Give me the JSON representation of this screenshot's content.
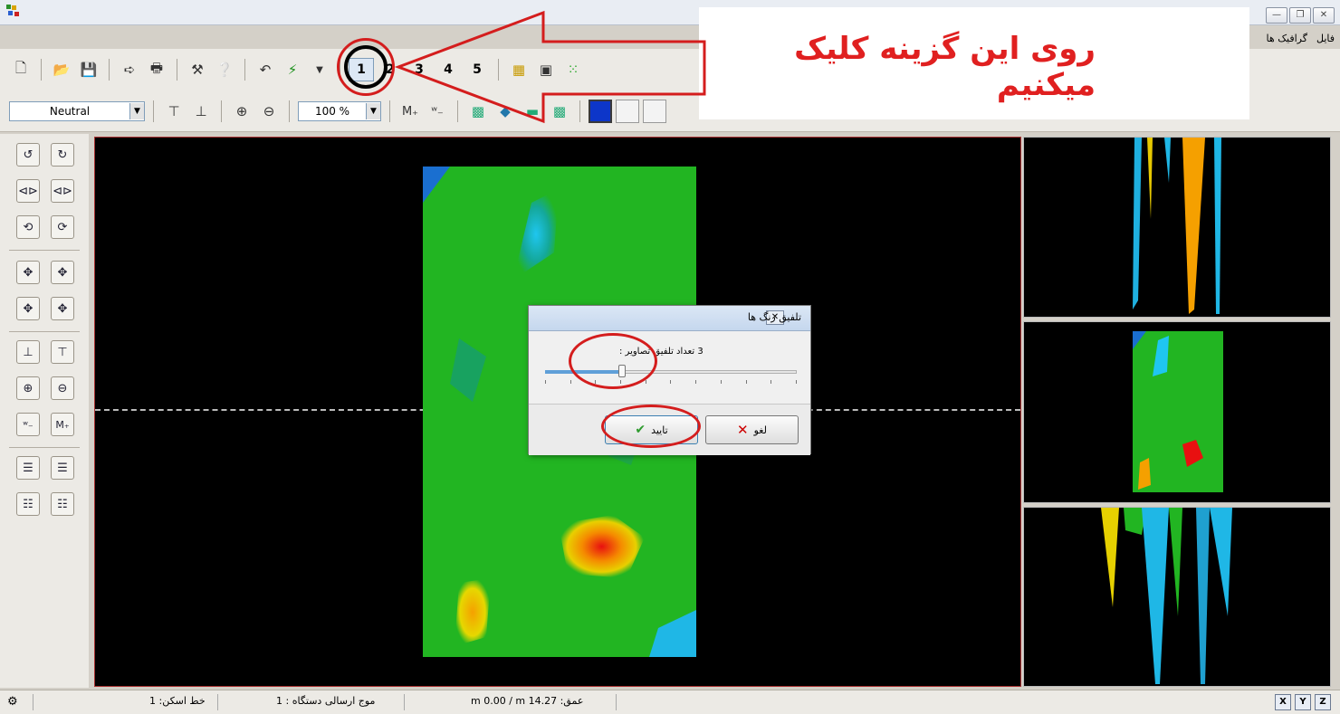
{
  "window": {
    "controls": [
      "—",
      "❐",
      "✕"
    ]
  },
  "menu": {
    "items": [
      "فایل",
      "گرافیک ها"
    ]
  },
  "toolbar": {
    "numbers": [
      "1",
      "2",
      "3",
      "4",
      "5"
    ],
    "palette_value": "Neutral",
    "zoom_value": "100 %"
  },
  "annotation": {
    "text": "روی این گزینه کلیک میکنیم"
  },
  "dialog": {
    "title": "تلفیق رنگ ها",
    "label": "3  تعداد تلفیق تصاویر :",
    "slider_value": 3,
    "slider_max": 10,
    "ok_label": "تایید",
    "cancel_label": "لغو"
  },
  "status": {
    "scan_line": "خط اسکن: 1",
    "device_wave": "موج ارسالی دستگاه : 1",
    "depth": "عمق: m 0.00 / m 14.27",
    "axes": [
      "X",
      "Y",
      "Z"
    ]
  },
  "colors": {
    "accent_red": "#e02020",
    "heat_green": "#22b522",
    "heat_cyan": "#1fb7e6",
    "heat_orange": "#f5a000",
    "heat_red": "#e81010"
  }
}
